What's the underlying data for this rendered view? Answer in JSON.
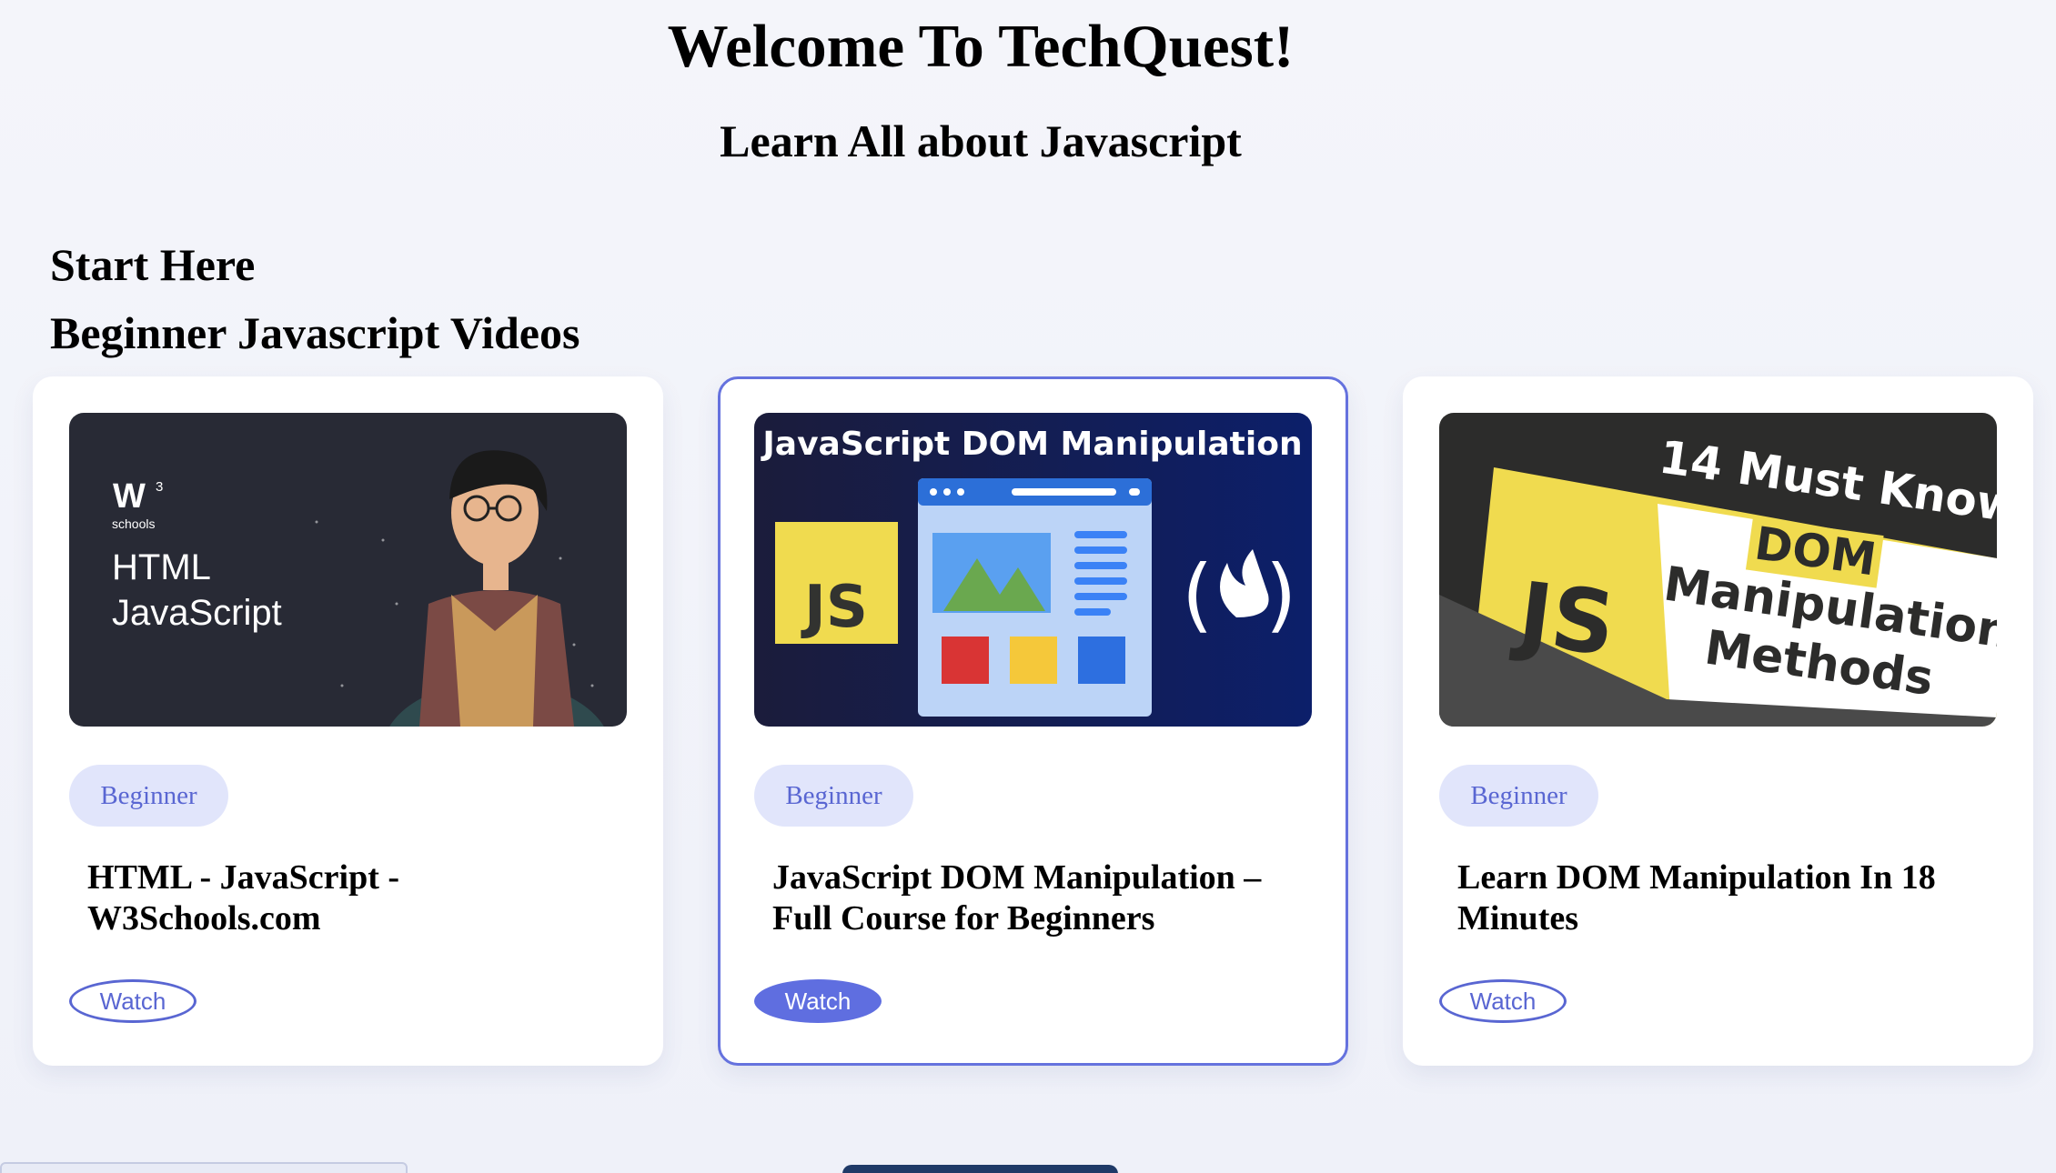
{
  "header": {
    "title": "Welcome To TechQuest!",
    "subtitle": "Learn All about Javascript"
  },
  "sections": {
    "start_heading": "Start Here",
    "videos_heading": "Beginner Javascript Videos"
  },
  "cards": [
    {
      "thumbnail": {
        "brand": "w3schools",
        "logo_mark": "W",
        "logo_sup": "3",
        "logo_sub": "schools",
        "line1": "HTML",
        "line2": "JavaScript"
      },
      "badge": "Beginner",
      "title": "HTML - JavaScript - W3Schools.com",
      "button": "Watch",
      "selected": false
    },
    {
      "thumbnail": {
        "heading": "JavaScript DOM Manipulation",
        "js_label": "JS",
        "logo_left": "(",
        "logo_right": ")"
      },
      "badge": "Beginner",
      "title": "JavaScript DOM Manipulation – Full Course for Beginners",
      "button": "Watch",
      "selected": true
    },
    {
      "thumbnail": {
        "line1": "14 Must Know",
        "line2": "DOM",
        "line3": "Manipulation",
        "line4": "Methods",
        "js_label": "JS"
      },
      "badge": "Beginner",
      "title": "Learn DOM Manipulation In 18 Minutes",
      "button": "Watch",
      "selected": false
    }
  ],
  "colors": {
    "accent": "#5f6ee0",
    "badge_bg": "#e1e5fb",
    "badge_text": "#5966d2",
    "selected_border": "#6572de",
    "js_yellow": "#f0db4f"
  }
}
